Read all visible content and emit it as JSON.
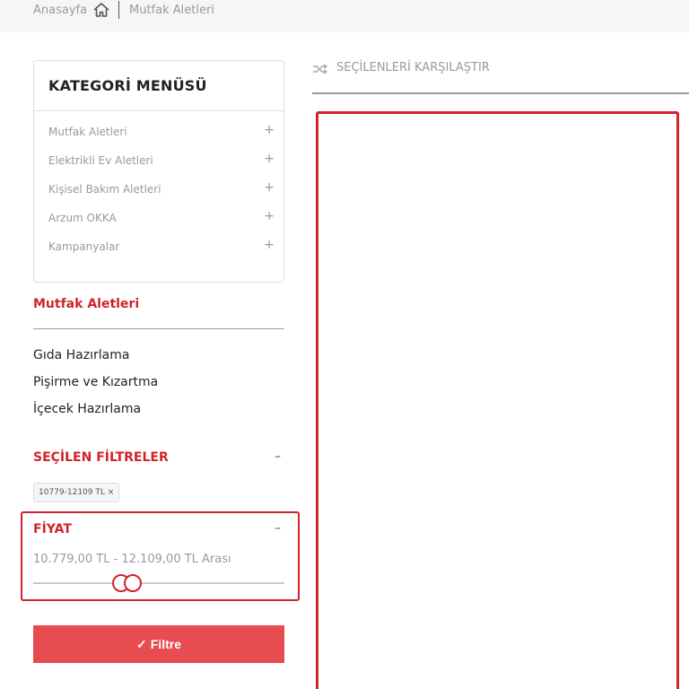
{
  "breadcrumb": {
    "home": "Anasayfa",
    "current": "Mutfak Aletleri"
  },
  "category_menu": {
    "title": "KATEGORİ MENÜSÜ",
    "items": [
      {
        "label": "Mutfak Aletleri",
        "toggle": "+"
      },
      {
        "label": "Elektrikli Ev Aletleri",
        "toggle": "+"
      },
      {
        "label": "Kişisel Bakım Aletleri",
        "toggle": "+"
      },
      {
        "label": "Arzum OKKA",
        "toggle": "+"
      },
      {
        "label": "Kampanyalar",
        "toggle": "+"
      }
    ]
  },
  "current_category": {
    "title": "Mutfak Aletleri",
    "subcategories": [
      "Gıda Hazırlama",
      "Pişirme ve Kızartma",
      "İçecek Hazırlama"
    ]
  },
  "selected_filters": {
    "title": "SEÇİLEN FİLTRELER",
    "collapse": "–",
    "chips": [
      "10779-12109 TL ×"
    ]
  },
  "price_filter": {
    "title": "FİYAT",
    "collapse": "–",
    "range_text": "10.779,00 TL - 12.109,00 TL Arası"
  },
  "filter_button": {
    "check": "✓",
    "label": "Filtre"
  },
  "compare": {
    "label": "SEÇİLENLERİ KARŞILAŞTIR"
  },
  "colors": {
    "accent_red": "#d0232b",
    "button_red": "#e64c50",
    "muted_text": "#9a9a9a"
  },
  "icons": [
    "home-icon",
    "shuffle-compare-icon",
    "plus-icon",
    "minus-icon",
    "check-icon"
  ]
}
